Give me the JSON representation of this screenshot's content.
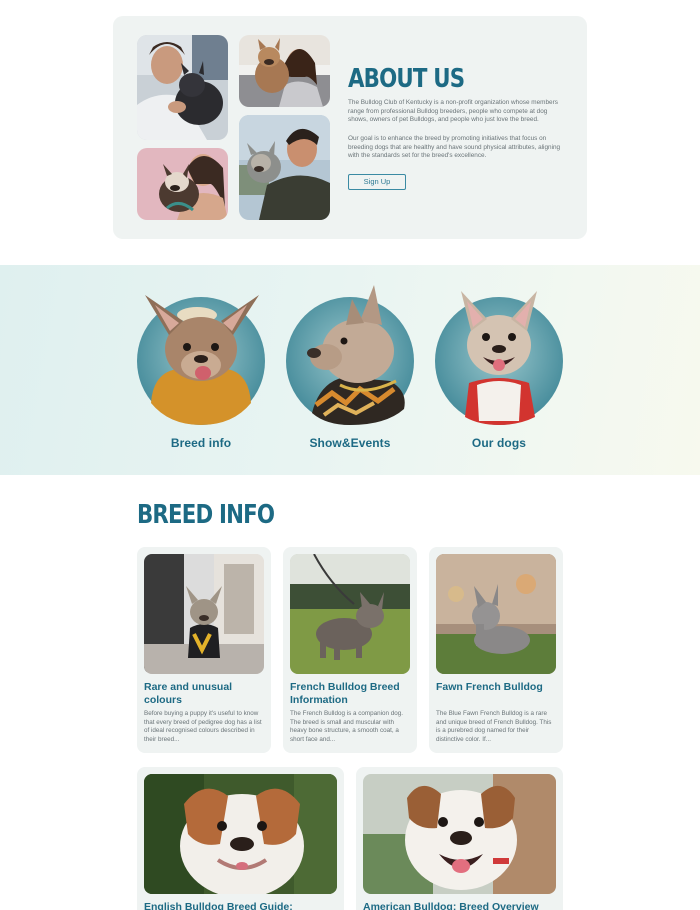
{
  "about": {
    "title": "ABOUT US",
    "paragraph1": "The Bulldog Club of Kentucky is a non-profit organization whose members range from professional Bulldog breeders, people who compete at dog shows, owners of pet Bulldogs, and people who just love the breed.",
    "paragraph2": "Our goal is to enhance the breed by promoting initiatives that focus on breeding dogs that are healthy and have sound physical attributes, aligning with the standards set for the breed's excellence.",
    "signup_label": "Sign Up"
  },
  "categories": [
    {
      "label": "Breed info"
    },
    {
      "label": "Show&Events"
    },
    {
      "label": "Our dogs"
    }
  ],
  "breed_info": {
    "title": "BREED INFO",
    "cards": [
      {
        "title": "Rare and unusual colours",
        "desc": "Before buying a puppy it's useful to know that every breed of pedigree dog has a list of ideal recognised colours described in their breed..."
      },
      {
        "title": "French Bulldog Breed Information",
        "desc": "The French Bulldog is a companion dog. The breed is small and muscular with heavy bone structure, a smooth coat, a short face and..."
      },
      {
        "title": "Fawn French Bulldog",
        "desc": "The Blue Fawn French Bulldog is a rare and unique breed of French Bulldog. This is a purebred dog named for their distinctive color. If..."
      },
      {
        "title": "English Bulldog Breed Guide:",
        "desc": ""
      },
      {
        "title": "American Bulldog: Breed Overview",
        "desc": ""
      }
    ]
  },
  "colors": {
    "accent": "#1d6a84",
    "card_bg": "#eff3f2",
    "circle": "#4f8f9b"
  }
}
